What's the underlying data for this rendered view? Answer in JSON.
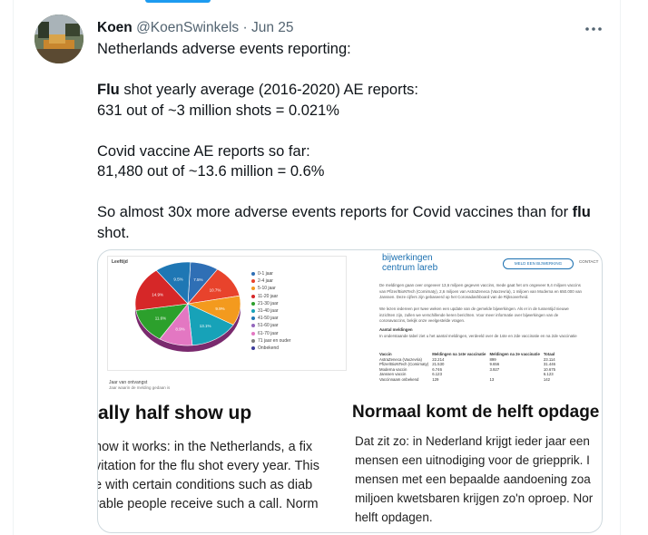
{
  "tweet": {
    "author_name": "Koen",
    "author_handle": "@KoenSwinkels",
    "separator": "·",
    "date": "Jun 25",
    "more_icon": "more-horizontal-icon",
    "lines": {
      "l1": "Netherlands adverse events reporting:",
      "l2_bold": "Flu",
      "l2_rest": " shot yearly average (2016-2020) AE reports:",
      "l3": "631 out of ~3 million shots = 0.021%",
      "l4": "Covid vaccine AE reports so far:",
      "l5": "81,480 out of ~13.6 million = 0.6%",
      "l6_a": "So almost 30x more adverse events reports for Covid vaccines than for ",
      "l6_bold": "flu",
      "l6_b": "shot."
    }
  },
  "media_left": {
    "chart_title": "Leeftijd",
    "slice_labels": [
      "7.5%",
      "10.7%",
      "9.9%",
      "13.1%",
      "8.9%",
      "11.6%",
      "14.9%",
      "9.5%"
    ],
    "legend": [
      "0-1 jaar",
      "2-4 jaar",
      "5-10 jaar",
      "11-20 jaar",
      "21-30 jaar",
      "31-40 jaar",
      "41-50 jaar",
      "51-60 jaar",
      "61-70 jaar",
      "71 jaar en ouder",
      "Onbekend"
    ],
    "legend_colors": [
      "#2f6fb5",
      "#e8432c",
      "#f39a1e",
      "#d62728",
      "#2ca02c",
      "#17a2b8",
      "#1f77b4",
      "#9467bd",
      "#e377c2",
      "#7f7f7f",
      "#3b3b9a"
    ],
    "footer_label": "Jaar van ontvangst",
    "footer_sub": "Jaar waarin de melding gedaan is",
    "headline": "ally half show up",
    "body_lines": [
      "how it works: in the Netherlands, a fix",
      "vitation for the flu shot every year. This",
      "e with certain conditions such as diab",
      "rable people receive such a call. Norm"
    ]
  },
  "media_right": {
    "logo_line1": "bijwerkingen",
    "logo_line2": "centrum lareb",
    "button": "MELD EEN BIJWERKING",
    "contact": "CONTACT",
    "para1": [
      "De meldingen gaan over ongeveer 13,6 miljoen gegeven vaccins, mede gaat het om ongeveer 9,4 miljoen vaccins",
      "van Pfizer/BioNTech (Comirnaty), 2,6 miljoen van AstraZeneca (Vaxzevria), 1 miljoen van Moderna en 650.000 van",
      "Janssen. Deze cijfers zijn gebaseerd op het Coronadashboard van de Rijksoverheid."
    ],
    "para2": [
      "We lezen iedereen per twee weken een update van de gemelde bijwerkingen. Als er in de tussentijd nieuwe",
      "inzichten zijn, zullen we verschillende keren berichten. Voor meer informatie over bijwerkingen van de",
      "coronavaccins, bekijk onze veelgestelde vragen."
    ],
    "section_title": "Aantal meldingen",
    "section_text": [
      "In onderstaande tabel ziet u het aantal meldingen, verdeeld over de 1ste en 2de vaccinatie en na 2de vaccinatie"
    ],
    "table_headers": [
      "Vaccin",
      "Meldingen na 1ste vaccinatie",
      "Meldingen na 2e vaccinatie",
      "Totaal"
    ],
    "table_rows": [
      [
        "AstraZeneca (Vaxzevria)",
        "22.214",
        "899",
        "23.114"
      ],
      [
        "Pfizer/BioNTech (Comirnaty)",
        "21.530",
        "9.656",
        "31.446"
      ],
      [
        "Moderna vaccin",
        "6.746",
        "3.927",
        "10.675"
      ],
      [
        "Janssen vaccin",
        "6.123",
        "",
        "6.123"
      ],
      [
        "Vaccinnaam onbekend",
        "129",
        "13",
        "142"
      ]
    ],
    "headline": "Normaal komt de helft opdage",
    "body_lines": [
      "Dat zit zo: in Nederland krijgt ieder jaar een",
      "mensen een uitnodiging voor de griepprik. I",
      "mensen met een bepaalde aandoening zoa",
      "miljoen kwetsbaren krijgen zo'n oproep. Nor",
      "helft opdagen."
    ]
  },
  "chart_data": {
    "type": "pie",
    "title": "Leeftijd",
    "categories": [
      "0-1 jaar",
      "2-4 jaar",
      "5-10 jaar",
      "11-20 jaar",
      "21-30 jaar",
      "31-40 jaar",
      "41-50 jaar",
      "51-60 jaar",
      "61-70 jaar",
      "71 jaar en ouder",
      "Onbekend"
    ],
    "visible_slice_labels": [
      "7.5%",
      "10.7%",
      "9.9%",
      "13.1%",
      "8.9%",
      "11.6%",
      "14.9%",
      "9.5%"
    ],
    "values": [
      7.5,
      10.7,
      9.9,
      13.1,
      8.9,
      11.6,
      14.9,
      9.5
    ]
  }
}
